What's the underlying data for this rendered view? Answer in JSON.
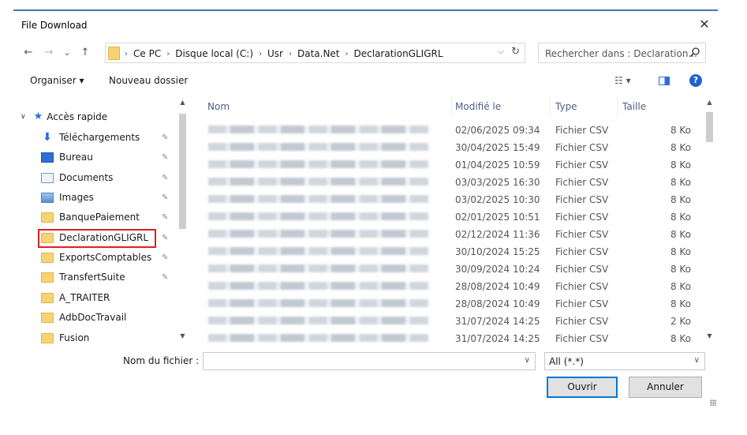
{
  "window": {
    "title": "File Download",
    "close_label": "✕"
  },
  "nav": {
    "back": "←",
    "forward": "→",
    "recent": "⌄",
    "up": "↑",
    "breadcrumbs": [
      "Ce PC",
      "Disque local (C:)",
      "Usr",
      "Data.Net",
      "DeclarationGLIGRL"
    ],
    "address_dropdown": "⌵",
    "refresh": "↻"
  },
  "search": {
    "placeholder": "Rechercher dans : Declaration...",
    "icon": "search-icon"
  },
  "toolbar": {
    "organise_label": "Organiser ▾",
    "new_folder_label": "Nouveau dossier",
    "view_label": "☷ ▾",
    "help_label": "?"
  },
  "sidebar": {
    "quick_access_label": "Accès rapide",
    "items": [
      {
        "label": "Téléchargements",
        "icon": "download-icon",
        "pinned": true
      },
      {
        "label": "Bureau",
        "icon": "desktop-icon",
        "pinned": true
      },
      {
        "label": "Documents",
        "icon": "document-icon",
        "pinned": true
      },
      {
        "label": "Images",
        "icon": "pictures-icon",
        "pinned": true
      },
      {
        "label": "BanquePaiement",
        "icon": "folder-icon",
        "pinned": true
      },
      {
        "label": "DeclarationGLIGRL",
        "icon": "folder-icon",
        "pinned": true,
        "selected": true
      },
      {
        "label": "ExportsComptables",
        "icon": "folder-icon",
        "pinned": true
      },
      {
        "label": "TransfertSuite",
        "icon": "folder-icon",
        "pinned": true
      },
      {
        "label": "A_TRAITER",
        "icon": "folder-icon",
        "pinned": false
      },
      {
        "label": "AdbDocTravail",
        "icon": "folder-icon",
        "pinned": false
      },
      {
        "label": "Fusion",
        "icon": "folder-icon",
        "pinned": false
      }
    ]
  },
  "files": {
    "columns": {
      "name": "Nom",
      "modified": "Modifié le",
      "type": "Type",
      "size": "Taille"
    },
    "rows": [
      {
        "modified": "02/06/2025 09:34",
        "type": "Fichier CSV",
        "size": "8 Ko"
      },
      {
        "modified": "30/04/2025 15:49",
        "type": "Fichier CSV",
        "size": "8 Ko"
      },
      {
        "modified": "01/04/2025 10:59",
        "type": "Fichier CSV",
        "size": "8 Ko"
      },
      {
        "modified": "03/03/2025 16:30",
        "type": "Fichier CSV",
        "size": "8 Ko"
      },
      {
        "modified": "03/02/2025 10:30",
        "type": "Fichier CSV",
        "size": "8 Ko"
      },
      {
        "modified": "02/01/2025 10:51",
        "type": "Fichier CSV",
        "size": "8 Ko"
      },
      {
        "modified": "02/12/2024 11:36",
        "type": "Fichier CSV",
        "size": "8 Ko"
      },
      {
        "modified": "30/10/2024 15:25",
        "type": "Fichier CSV",
        "size": "8 Ko"
      },
      {
        "modified": "30/09/2024 10:24",
        "type": "Fichier CSV",
        "size": "8 Ko"
      },
      {
        "modified": "28/08/2024 10:49",
        "type": "Fichier CSV",
        "size": "8 Ko"
      },
      {
        "modified": "28/08/2024 10:49",
        "type": "Fichier CSV",
        "size": "8 Ko"
      },
      {
        "modified": "31/07/2024 14:25",
        "type": "Fichier CSV",
        "size": "2 Ko"
      },
      {
        "modified": "31/07/2024 14:25",
        "type": "Fichier CSV",
        "size": "8 Ko"
      }
    ]
  },
  "footer": {
    "filename_label": "Nom du fichier :",
    "filename_value": "",
    "filter_value": "All (*.*)",
    "open_label": "Ouvrir",
    "cancel_label": "Annuler"
  }
}
